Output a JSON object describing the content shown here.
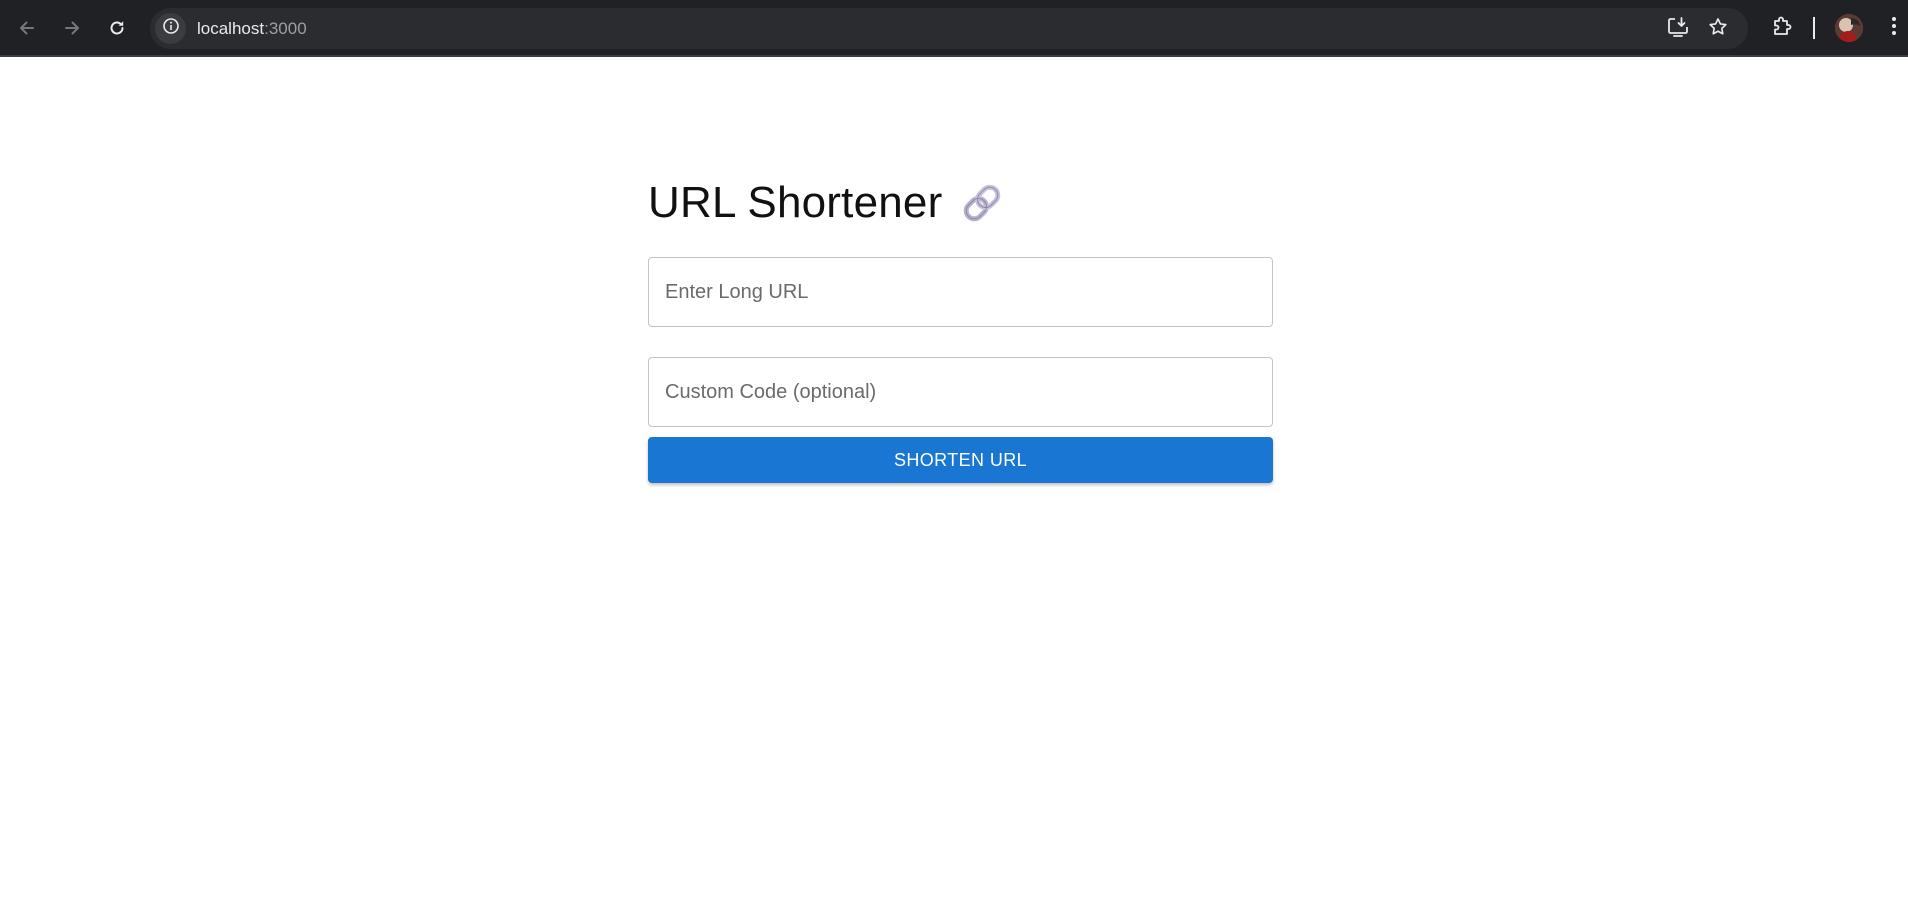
{
  "browser": {
    "url_host": "localhost",
    "url_port": ":3000"
  },
  "icons": {
    "back": "arrow-left-icon",
    "forward": "arrow-right-icon",
    "reload": "reload-icon",
    "site_info": "info-icon",
    "install": "install-app-icon",
    "bookmark": "star-icon",
    "extensions": "puzzle-icon",
    "menu": "kebab-menu-icon",
    "title_emoji": "link-emoji"
  },
  "page": {
    "title": "URL Shortener",
    "long_url_placeholder": "Enter Long URL",
    "custom_code_placeholder": "Custom Code (optional)",
    "submit_label": "SHORTEN URL"
  },
  "colors": {
    "chrome_background": "#202124",
    "button_primary": "#1976d2",
    "input_border": "#c4c4c4"
  }
}
